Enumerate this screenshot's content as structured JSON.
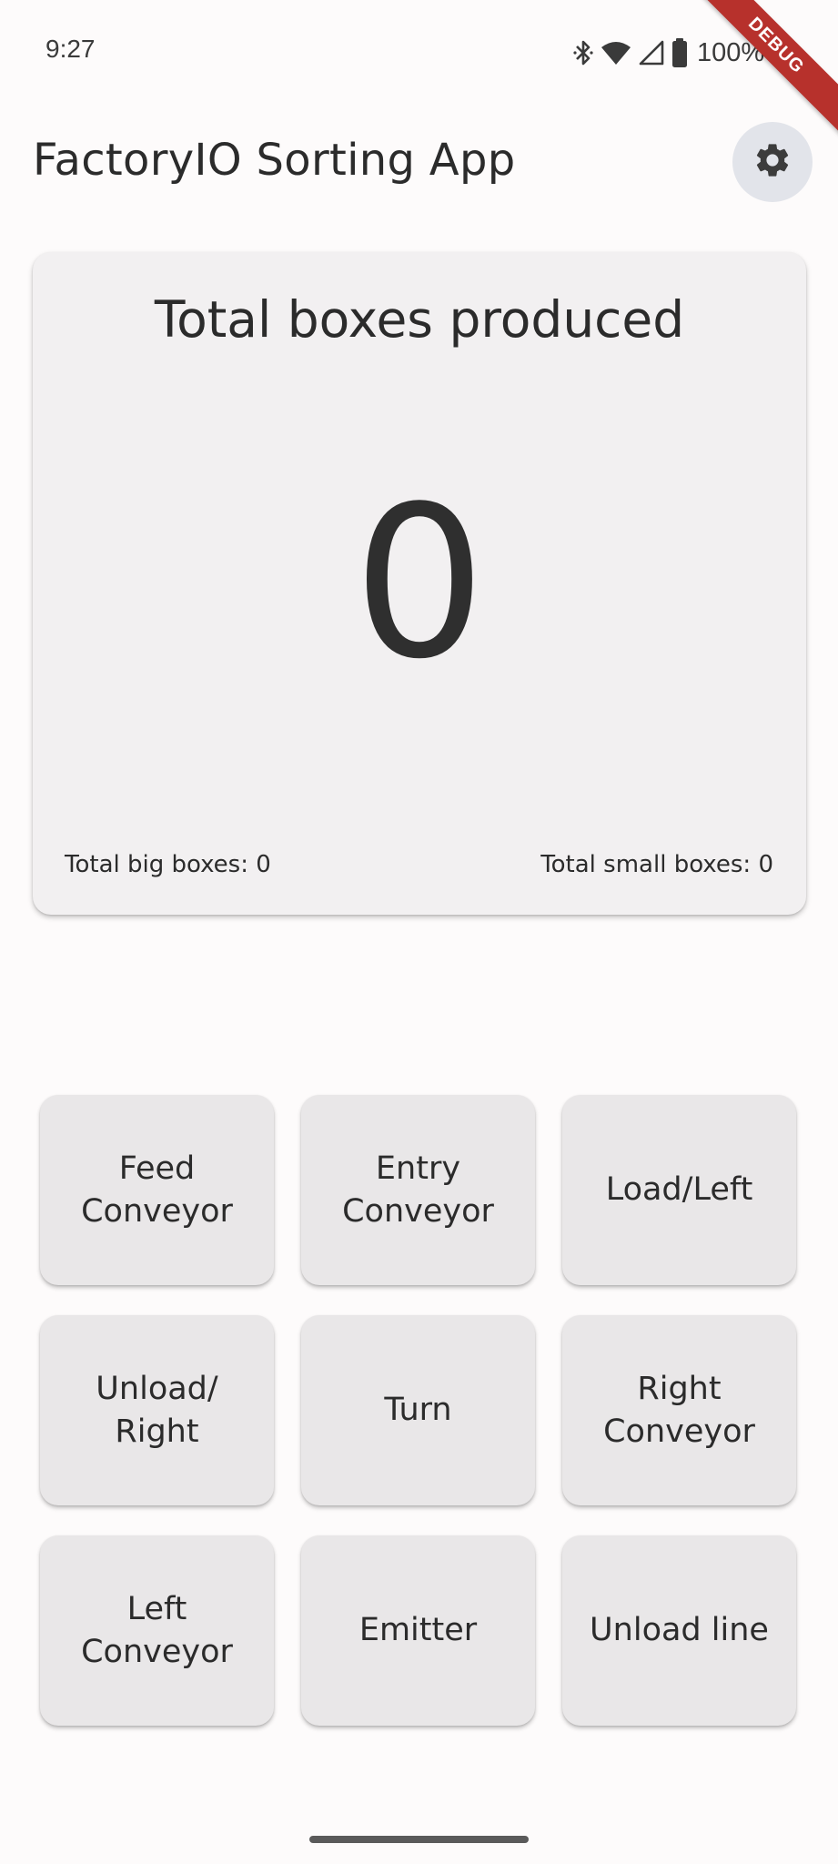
{
  "status_bar": {
    "time": "9:27",
    "battery_text": "100%",
    "icons": [
      "bluetooth-icon",
      "wifi-icon",
      "cellular-signal-icon",
      "battery-icon"
    ]
  },
  "debug_banner": "DEBUG",
  "app_bar": {
    "title": "FactoryIO Sorting App",
    "settings_icon": "gear-icon"
  },
  "summary": {
    "title": "Total boxes produced",
    "total": "0",
    "big_boxes_label": "Total big boxes: 0",
    "small_boxes_label": "Total small boxes: 0"
  },
  "controls": [
    "Feed\nConveyor",
    "Entry\nConveyor",
    "Load/Left",
    "Unload/\nRight",
    "Turn",
    "Right\nConveyor",
    "Left\nConveyor",
    "Emitter",
    "Unload line"
  ],
  "colors": {
    "background": "#fdfbfb",
    "card": "#f2f0f1",
    "button": "#e9e7e8",
    "settings_button": "#e2e4ea",
    "debug_banner": "#b7312c",
    "text": "#2b2b2b"
  }
}
